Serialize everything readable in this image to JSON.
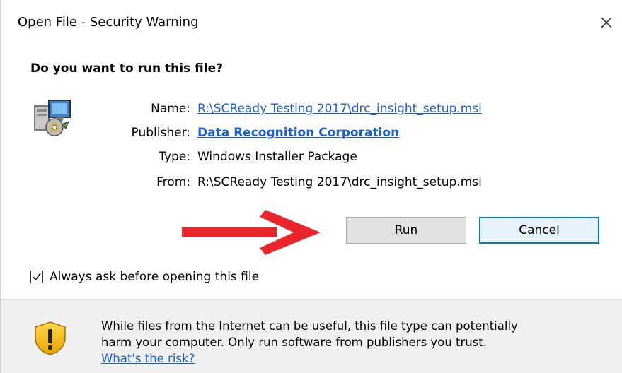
{
  "window": {
    "title": "Open File - Security Warning",
    "close_icon": "close-icon"
  },
  "prompt": {
    "question": "Do you want to run this file?"
  },
  "file_info": {
    "icon": "installer-package-icon",
    "name_label": "Name:",
    "name_value": "R:\\SCReady Testing 2017\\drc_insight_setup.msi",
    "publisher_label": "Publisher:",
    "publisher_value": "Data Recognition Corporation",
    "type_label": "Type:",
    "type_value": "Windows Installer Package",
    "from_label": "From:",
    "from_value": "R:\\SCReady Testing 2017\\drc_insight_setup.msi"
  },
  "buttons": {
    "run_label": "Run",
    "cancel_label": "Cancel"
  },
  "annotation": {
    "arrow_icon": "red-arrow-icon",
    "arrow_color": "#e8262b"
  },
  "options": {
    "always_ask_label": "Always ask before opening this file",
    "always_ask_checked": true
  },
  "footer": {
    "shield_icon": "warning-shield-icon",
    "warning_line1": "While files from the Internet can be useful, this file type can potentially",
    "warning_line2": "harm your computer. Only run software from publishers you trust.",
    "risk_link": "What's the risk?"
  },
  "colors": {
    "link": "#1a5fd1",
    "accent_border": "#0078d7",
    "footer_bg": "#f0f0f0"
  }
}
